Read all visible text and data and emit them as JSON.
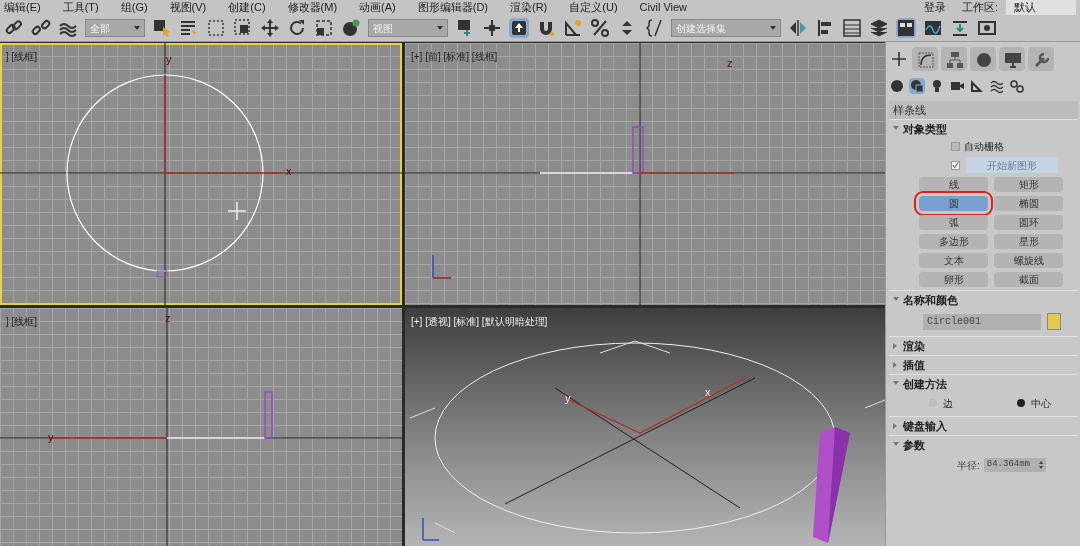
{
  "menu_bar": {
    "items": [
      "编辑(E)",
      "工具(T)",
      "组(G)",
      "视图(V)",
      "创建(C)",
      "修改器(M)",
      "动画(A)",
      "图形编辑器(D)",
      "渲染(R)",
      "自定义(U)",
      "Civil View"
    ],
    "sign_in": "登录",
    "workspace_label": "工作区:",
    "workspace_value": "默认"
  },
  "toolbar": {
    "selection_filter": "全部",
    "reference_coord": "视图",
    "named_selection": "创建选择集"
  },
  "viewports": [
    {
      "kind": "top",
      "label": "] [线框]",
      "active": true,
      "axis_labels": [
        "y",
        "x"
      ]
    },
    {
      "kind": "front",
      "label": "[+] [前] [标准] [线框]",
      "active": false,
      "axis_labels": [
        "z"
      ]
    },
    {
      "kind": "left",
      "label": "] [线框]",
      "active": false,
      "axis_labels": [
        "z",
        "y"
      ]
    },
    {
      "kind": "perspective",
      "label": "[+] [透视] [标准] [默认明暗处理]",
      "active": false,
      "axis_labels": [
        "y",
        "x"
      ]
    }
  ],
  "command_panel": {
    "categories": [
      {
        "selected": false
      },
      {
        "selected": true
      },
      {
        "selected": false
      },
      {
        "selected": false
      },
      {
        "selected": false
      },
      {
        "selected": false
      },
      {
        "selected": false
      }
    ],
    "subcategory": "样条线",
    "rollouts": [
      {
        "kind": "object_type",
        "title": "对象类型",
        "expanded": true,
        "auto_grid": {
          "label": "自动栅格",
          "checked": false
        },
        "start_new_shape": {
          "label": "开始新图形",
          "checked": true
        },
        "buttons": [
          {
            "label": "线",
            "selected": false,
            "annotated": false
          },
          {
            "label": "矩形",
            "selected": false,
            "annotated": false
          },
          {
            "label": "圆",
            "selected": true,
            "annotated": true
          },
          {
            "label": "椭圆",
            "selected": false,
            "annotated": false
          },
          {
            "label": "弧",
            "selected": false,
            "annotated": false
          },
          {
            "label": "圆环",
            "selected": false,
            "annotated": false
          },
          {
            "label": "多边形",
            "selected": false,
            "annotated": false
          },
          {
            "label": "星形",
            "selected": false,
            "annotated": false
          },
          {
            "label": "文本",
            "selected": false,
            "annotated": false
          },
          {
            "label": "螺旋线",
            "selected": false,
            "annotated": false
          },
          {
            "label": "卵形",
            "selected": false,
            "annotated": false
          },
          {
            "label": "截面",
            "selected": false,
            "annotated": false
          }
        ]
      },
      {
        "kind": "name_color",
        "title": "名称和颜色",
        "expanded": true,
        "name": "Circle001",
        "color": "#e6c84a"
      },
      {
        "title": "渲染",
        "expanded": false
      },
      {
        "title": "插值",
        "expanded": false
      },
      {
        "kind": "radios",
        "title": "创建方法",
        "expanded": true,
        "options": [
          {
            "label": "边",
            "selected": false
          },
          {
            "label": "中心",
            "selected": true
          }
        ]
      },
      {
        "title": "键盘输入",
        "expanded": false
      },
      {
        "kind": "parameter",
        "title": "参数",
        "expanded": true,
        "field_label": "半径:",
        "value": "84.364mm"
      }
    ]
  }
}
